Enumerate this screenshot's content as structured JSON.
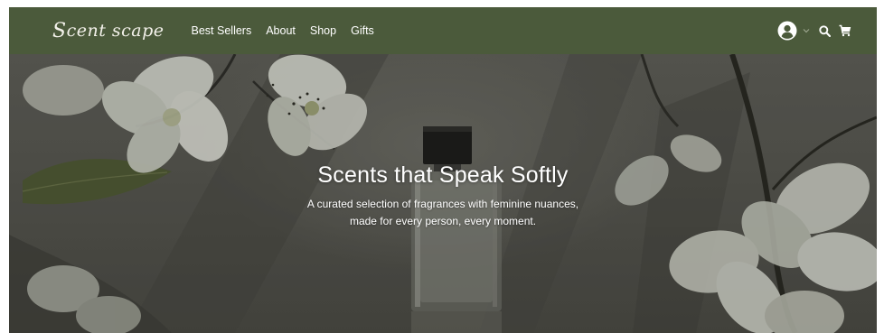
{
  "nav": {
    "logo_text": "cent scape",
    "logo_initial": "S",
    "links": [
      "Best Sellers",
      "About",
      "Shop",
      "Gifts"
    ],
    "icons": {
      "account": "user-circle-icon",
      "dropdown": "chevron-down-icon",
      "search": "search-icon",
      "cart": "cart-icon"
    }
  },
  "hero": {
    "title": "Scents that Speak Softly",
    "subtitle_line1": "A curated selection of fragrances with feminine nuances,",
    "subtitle_line2": "made for every person, every moment."
  },
  "colors": {
    "navbar_bg": "#4b5a3b",
    "text": "#ffffff"
  }
}
